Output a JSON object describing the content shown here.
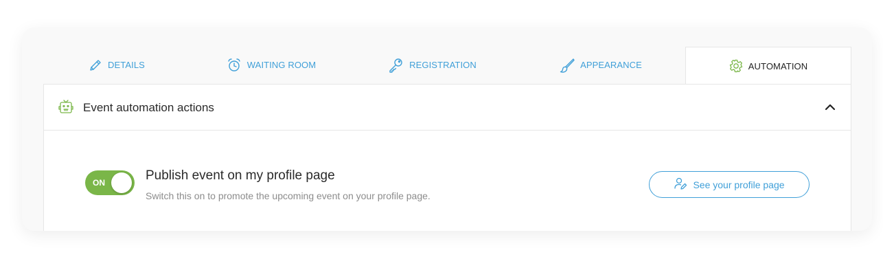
{
  "tabs": [
    {
      "label": "DETAILS",
      "icon": "pencil-icon",
      "active": false
    },
    {
      "label": "WAITING ROOM",
      "icon": "alarm-clock-icon",
      "active": false
    },
    {
      "label": "REGISTRATION",
      "icon": "key-icon",
      "active": false
    },
    {
      "label": "APPEARANCE",
      "icon": "paintbrush-icon",
      "active": false
    },
    {
      "label": "AUTOMATION",
      "icon": "gear-icon",
      "active": true
    }
  ],
  "panel": {
    "title": "Event automation actions",
    "icon": "robot-icon",
    "collapse_icon": "chevron-up-icon"
  },
  "setting": {
    "toggle_label": "ON",
    "toggle_on": true,
    "title": "Publish event on my profile page",
    "description": "Switch this on to promote the upcoming event on your profile page.",
    "button_label": "See your profile page",
    "button_icon": "user-edit-icon"
  },
  "colors": {
    "accent_blue": "#3f9fd8",
    "accent_green": "#7ab648",
    "text_dark": "#2a2a2a",
    "text_muted": "#8c8c8c",
    "border": "#e6e6e6"
  }
}
